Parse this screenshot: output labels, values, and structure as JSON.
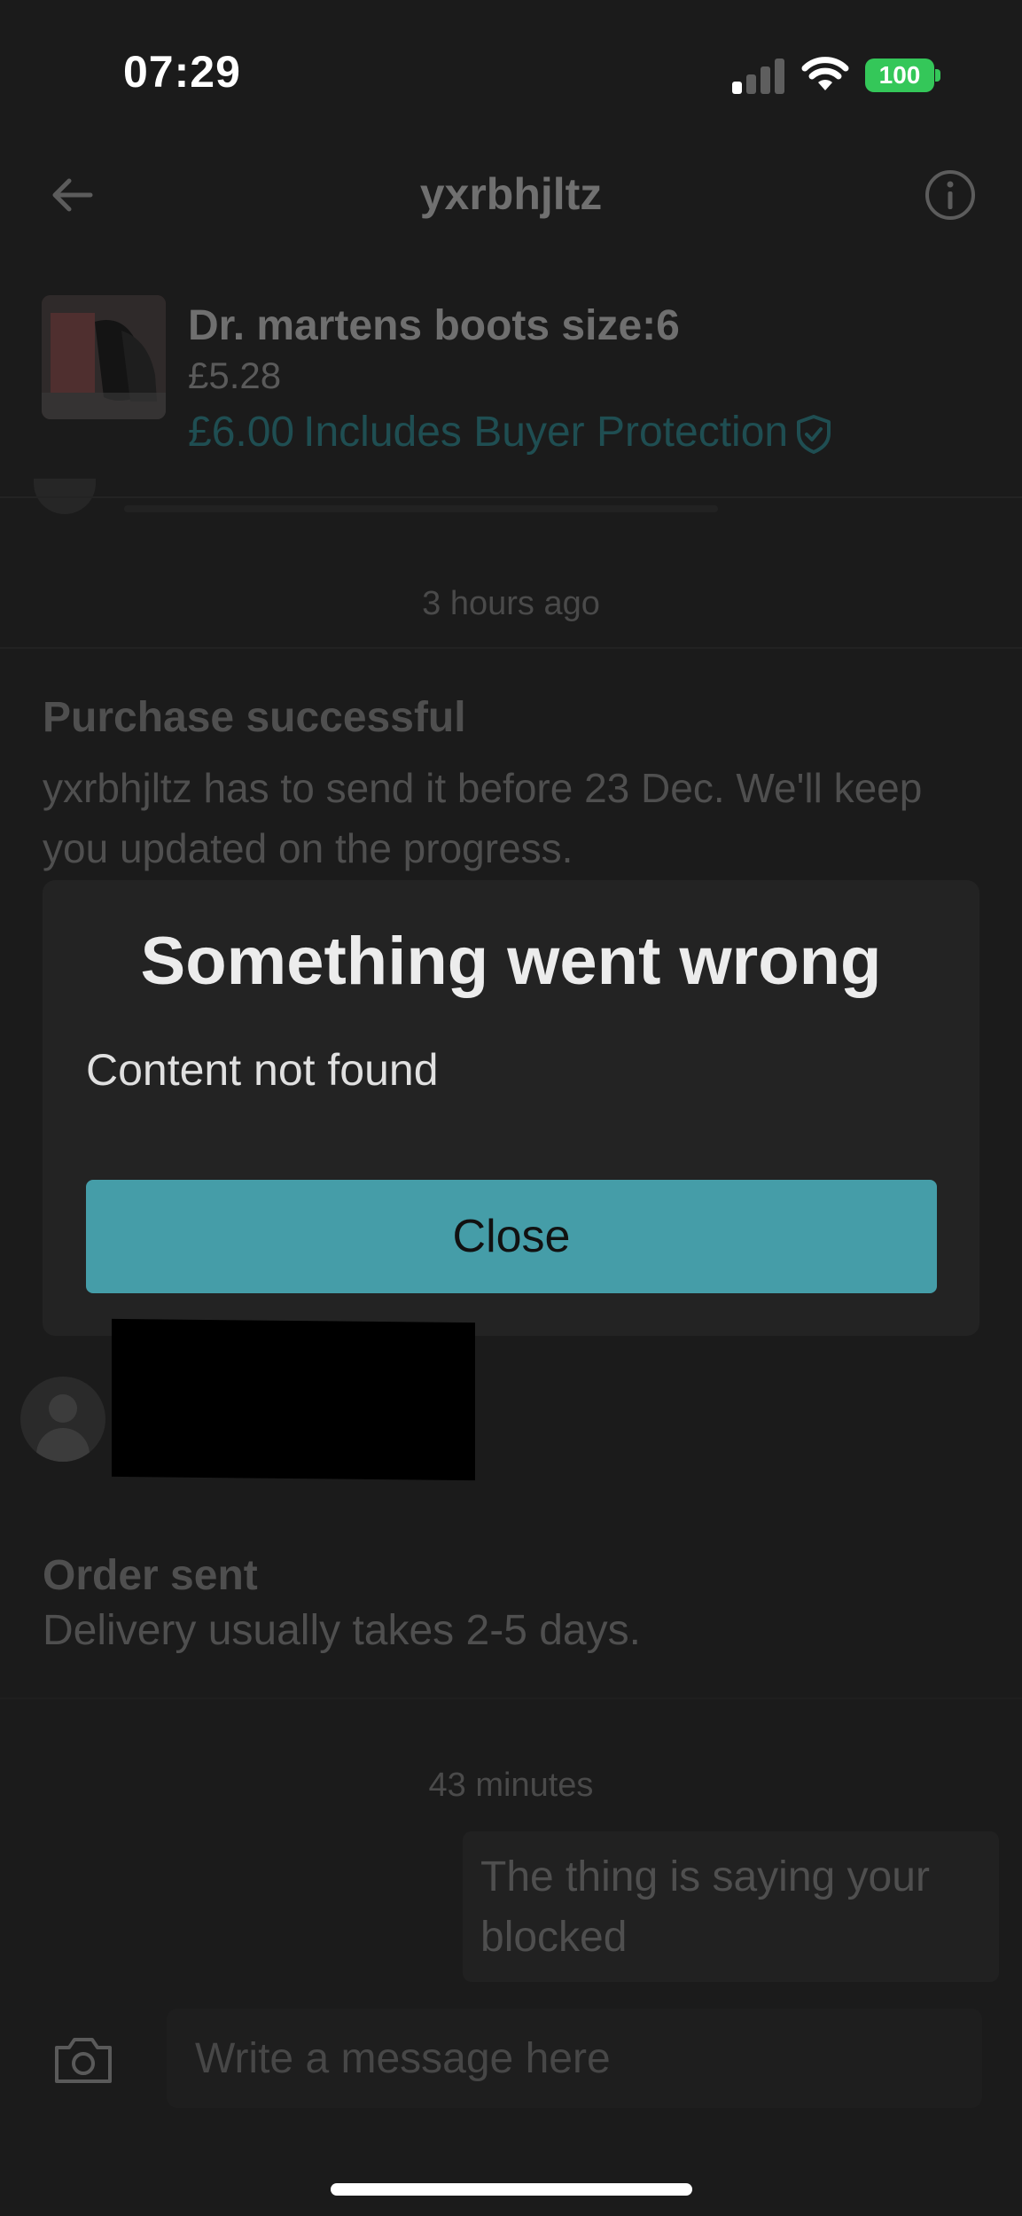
{
  "status_bar": {
    "time": "07:29",
    "battery": "100"
  },
  "header": {
    "username": "yxrbhjltz"
  },
  "item": {
    "title": "Dr. martens boots size:6",
    "price": "£5.28",
    "total_price": "£6.00",
    "protection_text": "Includes Buyer Protection"
  },
  "timeline": [
    {
      "timestamp": "3 hours ago"
    },
    {
      "title": "Purchase successful",
      "body": "yxrbhjltz has to send it before 23 Dec. We'll keep you updated on the progress."
    },
    {
      "title": "Order sent",
      "body": "Delivery usually takes 2-5 days."
    },
    {
      "timestamp": "43 minutes"
    },
    {
      "message": "The thing is saying your blocked"
    }
  ],
  "dialog": {
    "title": "Something went wrong",
    "message": "Content not found",
    "button_label": "Close"
  },
  "composer": {
    "placeholder": "Write a message here"
  },
  "colors": {
    "accent": "#459da8",
    "background": "#1b1b1b",
    "dialog": "#232323",
    "battery": "#34c759"
  },
  "icons": [
    "back-arrow-icon",
    "info-icon",
    "shield-check-icon",
    "camera-icon",
    "wifi-icon",
    "signal-icon"
  ]
}
